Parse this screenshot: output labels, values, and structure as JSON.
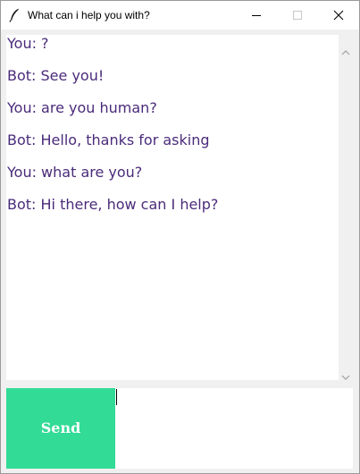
{
  "window": {
    "title": "What can i help you with?",
    "icon": "feather-icon",
    "controls": [
      "minimize-icon",
      "maximize-icon",
      "close-icon"
    ]
  },
  "chat": {
    "messages": [
      "You: ?",
      "Bot: See you!",
      "You: are you human?",
      "Bot: Hello, thanks for asking",
      "You: what are you?",
      "Bot: Hi there, how can I help?"
    ],
    "text_color": "#4a2b7a"
  },
  "input": {
    "value": "",
    "send_label": "Send",
    "send_color": "#32db96"
  }
}
